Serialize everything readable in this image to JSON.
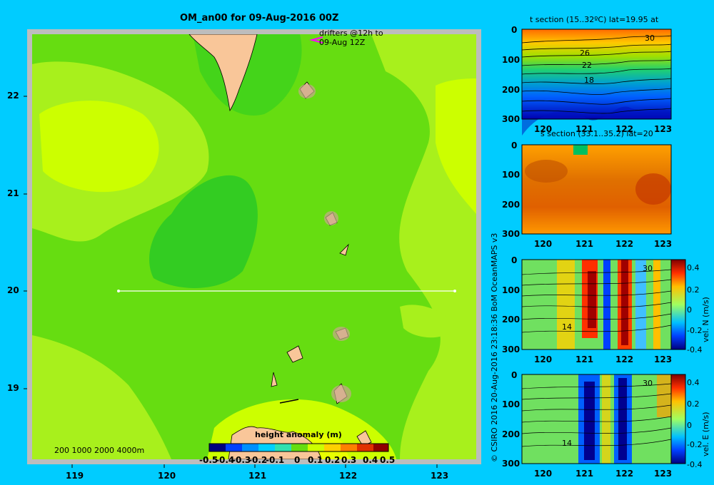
{
  "main_map": {
    "title": "OM_an00 for 09-Aug-2016 00Z",
    "drifter_note_line1": "drifters @12h to",
    "drifter_note_line2": "09-Aug 12Z",
    "depth_legend": "200  1000  2000  4000m",
    "x_ticks": [
      "119",
      "120",
      "121",
      "122",
      "123"
    ],
    "y_ticks": [
      "22",
      "21",
      "20",
      "19"
    ],
    "section_line": {
      "lat": 20,
      "lon_start": 119.5,
      "lon_end": 123.2
    },
    "colorbar": {
      "title": "height anomaly  (m)",
      "ticks": [
        "-0.5",
        "-0.4",
        "-0.3",
        "-0.2",
        "-0.1",
        "0",
        "0.1",
        "0.2",
        "0.3",
        "0.4",
        "0.5"
      ]
    },
    "colors": {
      "land": "#f9c699",
      "shelf": "#c8a88c",
      "frame": "#bdbdbd"
    }
  },
  "credit": "© CSIRO 2016   20-Aug-2016 23:18:36 BoM OceanMAPS v3",
  "panels": [
    {
      "title": "t section (15..32ºC) lat=19.95 at",
      "x_ticks": [
        "120",
        "121",
        "122",
        "123"
      ],
      "y_ticks": [
        "0",
        "100",
        "200",
        "300"
      ],
      "contour_labels": [
        "30",
        "26",
        "22",
        "18"
      ]
    },
    {
      "title": "s section (33.1..35.2) lat=20",
      "x_ticks": [
        "120",
        "121",
        "122",
        "123"
      ],
      "y_ticks": [
        "0",
        "100",
        "200",
        "300"
      ]
    },
    {
      "x_ticks": [
        "120",
        "121",
        "122",
        "123"
      ],
      "y_ticks": [
        "0",
        "100",
        "200",
        "300"
      ],
      "contour_labels": [
        "30",
        "14"
      ],
      "cb_label": "vel. N (m/s)",
      "cb_ticks": [
        "0.4",
        "0.2",
        "0",
        "-0.2",
        "-0.4"
      ]
    },
    {
      "x_ticks": [
        "120",
        "121",
        "122",
        "123"
      ],
      "y_ticks": [
        "0",
        "100",
        "200",
        "300"
      ],
      "contour_labels": [
        "30",
        "14"
      ],
      "cb_label": "vel. E (m/s)",
      "cb_ticks": [
        "0.4",
        "0.2",
        "0",
        "-0.2",
        "-0.4"
      ]
    }
  ],
  "chart_data": [
    {
      "type": "heatmap",
      "title": "OM_an00 for 09-Aug-2016 00Z",
      "xlabel": "",
      "ylabel": "",
      "xlim": [
        118.5,
        123.5
      ],
      "ylim": [
        18.3,
        22.7
      ],
      "colorbar_label": "height anomaly  (m)",
      "colorbar_range": [
        -0.5,
        0.5
      ]
    },
    {
      "type": "heatmap",
      "title": "t section (15..32ºC) lat=19.95 at",
      "xlim": [
        119.6,
        123.1
      ],
      "ylim": [
        300,
        0
      ],
      "value_range": [
        15,
        32
      ]
    },
    {
      "type": "heatmap",
      "title": "s section (33.1..35.2) lat=20",
      "xlim": [
        119.6,
        123.1
      ],
      "ylim": [
        300,
        0
      ],
      "value_range": [
        33.1,
        35.2
      ]
    },
    {
      "type": "heatmap",
      "colorbar_label": "vel. N (m/s)",
      "xlim": [
        119.6,
        123.1
      ],
      "ylim": [
        300,
        0
      ],
      "value_range": [
        -0.4,
        0.4
      ]
    },
    {
      "type": "heatmap",
      "colorbar_label": "vel. E (m/s)",
      "xlim": [
        119.6,
        123.1
      ],
      "ylim": [
        300,
        0
      ],
      "value_range": [
        -0.4,
        0.4
      ]
    }
  ]
}
